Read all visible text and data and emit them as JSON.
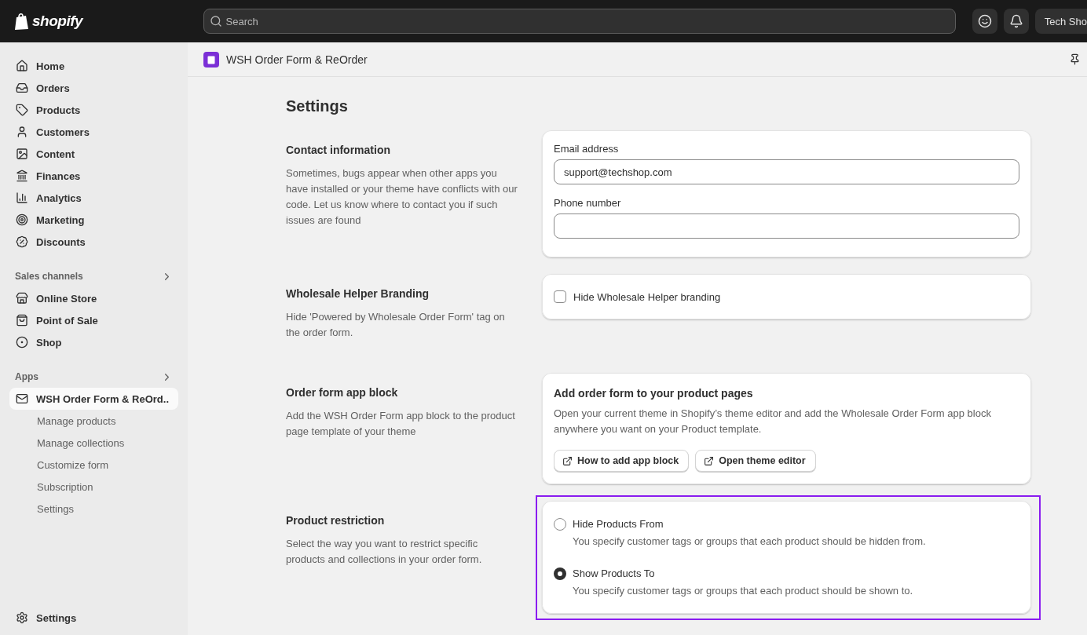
{
  "topbar": {
    "logo": "shopify",
    "search": {
      "placeholder": "Search"
    },
    "store_button": "Tech Sho"
  },
  "sidebar": {
    "nav": [
      {
        "label": "Home"
      },
      {
        "label": "Orders"
      },
      {
        "label": "Products"
      },
      {
        "label": "Customers"
      },
      {
        "label": "Content"
      },
      {
        "label": "Finances"
      },
      {
        "label": "Analytics"
      },
      {
        "label": "Marketing"
      },
      {
        "label": "Discounts"
      }
    ],
    "sections": [
      {
        "heading": "Sales channels",
        "items": [
          {
            "label": "Online Store",
            "selected": false
          },
          {
            "label": "Point of Sale",
            "selected": false
          },
          {
            "label": "Shop",
            "selected": false
          }
        ]
      },
      {
        "heading": "Apps",
        "items": [
          {
            "label": "WSH Order Form & ReOrd..",
            "selected": true,
            "children": [
              {
                "label": "Manage products"
              },
              {
                "label": "Manage collections"
              },
              {
                "label": "Customize form"
              },
              {
                "label": "Subscription"
              },
              {
                "label": "Settings"
              }
            ]
          }
        ]
      }
    ],
    "footer": "Settings"
  },
  "app_header": {
    "title": "WSH Order Form & ReOrder"
  },
  "page": {
    "title": "Settings",
    "sections": [
      {
        "kind": "fields",
        "heading": "Contact information",
        "description": "Sometimes, bugs appear when other apps you have installed or your theme have conflicts with our code. Let us know where to contact you if such issues are found",
        "highlighted": false,
        "fields": [
          {
            "label": "Email address",
            "value": "support@techshop.com"
          },
          {
            "label": "Phone number"
          }
        ]
      },
      {
        "kind": "checkbox",
        "heading": "Wholesale Helper Branding",
        "description": "Hide 'Powered by Wholesale Order Form' tag on the order form.",
        "highlighted": false,
        "checkbox": {
          "label": "Hide Wholesale Helper branding",
          "checked": false
        }
      },
      {
        "kind": "info",
        "heading": "Order form app block",
        "description": "Add the WSH Order Form app block to the product page template of your theme",
        "highlighted": false,
        "card_title": "Add order form to your product pages",
        "card_text": "Open your current theme in Shopify’s theme editor and add the Wholesale Order Form app block anywhere you want on your Product template.",
        "buttons": [
          "How to add app block",
          "Open theme editor"
        ]
      },
      {
        "kind": "radio",
        "heading": "Product restriction",
        "description": "Select the way you want to restrict specific products and collections in your order form.",
        "highlighted": true,
        "options": [
          {
            "label": "Hide Products From",
            "help": "You specify customer tags or groups that each product should be hidden from.",
            "selected": false
          },
          {
            "label": "Show Products To",
            "help": "You specify customer tags or groups that each product should be shown to.",
            "selected": true
          }
        ]
      }
    ]
  }
}
